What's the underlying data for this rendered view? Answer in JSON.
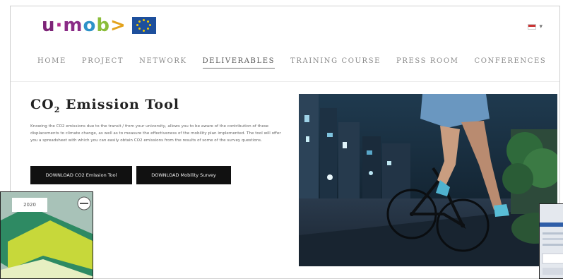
{
  "logo": {
    "text_parts": [
      "u",
      "·",
      "m",
      "o",
      "b",
      ">"
    ],
    "brand_colors": {
      "purple": "#7d2477",
      "magenta": "#b12b8c",
      "blue": "#2d92c8",
      "green": "#8bbd3a",
      "orange": "#e3a21b"
    },
    "flag_icon": "eu-flag-icon"
  },
  "language": {
    "flag_icon": "language-flag-icon",
    "caret": "▾"
  },
  "nav": {
    "items": [
      "HOME",
      "PROJECT",
      "NETWORK",
      "DELIVERABLES",
      "TRAINING COURSE",
      "PRESS ROOM",
      "CONFERENCES"
    ],
    "active": "DELIVERABLES"
  },
  "content": {
    "title_main": "CO",
    "title_sub": "2",
    "title_rest": " Emission Tool",
    "paragraph": "Knowing the CO2 emissions due to the transit / from your university, allows you to be aware of the contribution of these displacements to climate change, as well as to measure the effectiveness of the mobility plan implemented. The tool will offer you a spreadsheet with which you can easily obtain CO2 emissions from the results of some of the survey questions."
  },
  "buttons": {
    "co2_tool": "DOWNLOAD CO2 Emission Tool",
    "survey": "DOWNLOAD Mobility Survey"
  },
  "thumbnail_left": {
    "label": "2020"
  },
  "colors": {
    "button_bg": "#111111",
    "nav_text": "#8a8a8a"
  }
}
